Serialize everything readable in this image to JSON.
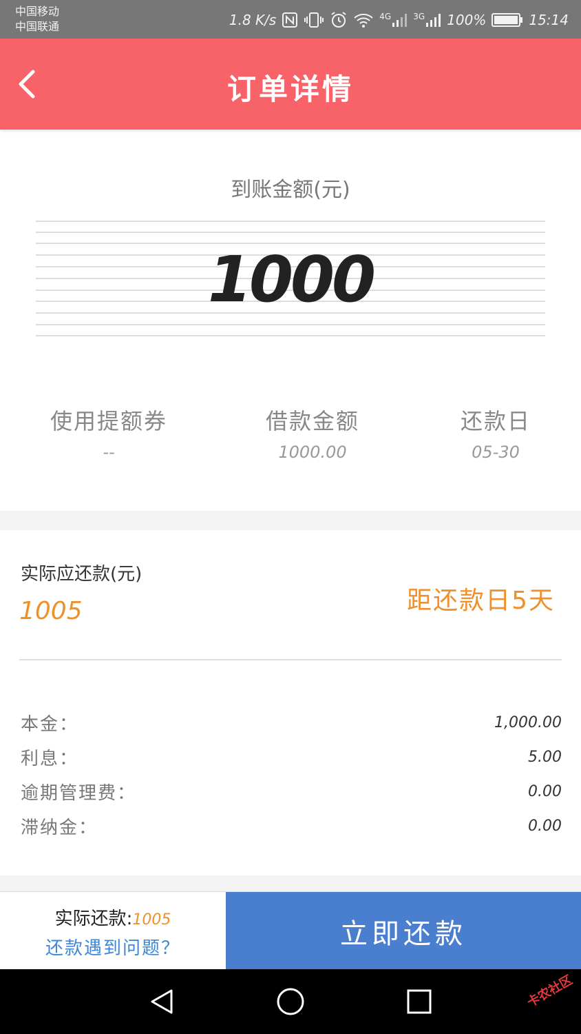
{
  "status_bar": {
    "carrier1": "中国移动",
    "carrier2": "中国联通",
    "speed": "1.8 K/s",
    "net1": "4G",
    "net2": "3G",
    "battery": "100%",
    "time": "15:14"
  },
  "header": {
    "title": "订单详情"
  },
  "amount": {
    "label": "到账金额(元)",
    "value": "1000"
  },
  "info": [
    {
      "title": "使用提额券",
      "value": "--"
    },
    {
      "title": "借款金额",
      "value": "1000.00"
    },
    {
      "title": "还款日",
      "value": "05-30"
    }
  ],
  "repay": {
    "label": "实际应还款(元)",
    "value": "1005",
    "countdown": "距还款日5天"
  },
  "fees": [
    {
      "label": "本金：",
      "value": "1,000.00"
    },
    {
      "label": "利息：",
      "value": "5.00"
    },
    {
      "label": "逾期管理费：",
      "value": "0.00"
    },
    {
      "label": "滞纳金：",
      "value": "0.00"
    }
  ],
  "bottom": {
    "actual_label": "实际还款:",
    "actual_value": "1005",
    "help": "还款遇到问题？",
    "button": "立即还款"
  },
  "watermark": "卡农社区",
  "colors": {
    "header": "#f8636a",
    "accent_orange": "#f0902a",
    "button_blue": "#4a7fd0",
    "link_blue": "#3d86d8"
  }
}
